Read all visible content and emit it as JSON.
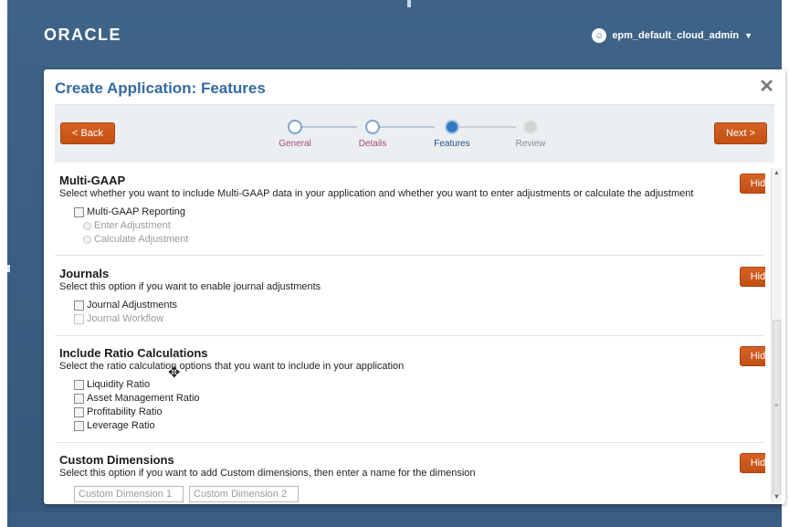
{
  "header": {
    "brand": "ORACLE",
    "username": "epm_default_cloud_admin",
    "user_icon": "user-icon",
    "dropdown_icon": "chevron-down-icon"
  },
  "dialog": {
    "title": "Create Application: Features",
    "close_glyph": "✕"
  },
  "train": {
    "back_label": "< Back",
    "next_label": "Next >",
    "steps": [
      {
        "label": "General",
        "state": "visited"
      },
      {
        "label": "Details",
        "state": "visited"
      },
      {
        "label": "Features",
        "state": "current"
      },
      {
        "label": "Review",
        "state": "future"
      }
    ]
  },
  "sections": {
    "multi_gaap": {
      "heading": "Multi-GAAP",
      "description": "Select whether you want to include Multi-GAAP data in your application and whether you want to enter adjustments or calculate the adjustment",
      "hide_label": "Hide",
      "options": {
        "reporting": "Multi-GAAP Reporting",
        "enter_adjustment": "Enter Adjustment",
        "calculate_adjustment": "Calculate Adjustment"
      }
    },
    "journals": {
      "heading": "Journals",
      "description": "Select this option if you want to enable journal adjustments",
      "hide_label": "Hide",
      "options": {
        "adjustments": "Journal Adjustments",
        "workflow": "Journal Workflow"
      }
    },
    "ratios": {
      "heading": "Include Ratio Calculations",
      "description": "Select the ratio calculation options that you want to include in your application",
      "hide_label": "Hide",
      "options": {
        "liquidity": "Liquidity Ratio",
        "asset_management": "Asset Management Ratio",
        "profitability": "Profitability Ratio",
        "leverage": "Leverage Ratio"
      }
    },
    "custom_dimensions": {
      "heading": "Custom Dimensions",
      "description": "Select this option if you want to add Custom dimensions, then enter a name for the dimension",
      "hide_label": "Hide",
      "inputs": {
        "dim1_placeholder": "Custom Dimension 1",
        "dim2_placeholder": "Custom Dimension 2"
      }
    }
  },
  "colors": {
    "header_bg": "#3f6488",
    "title_blue": "#356aa0",
    "button_orange": "#c9561a",
    "current_step": "#2f7bc4"
  },
  "cursor": "move-cursor-icon"
}
